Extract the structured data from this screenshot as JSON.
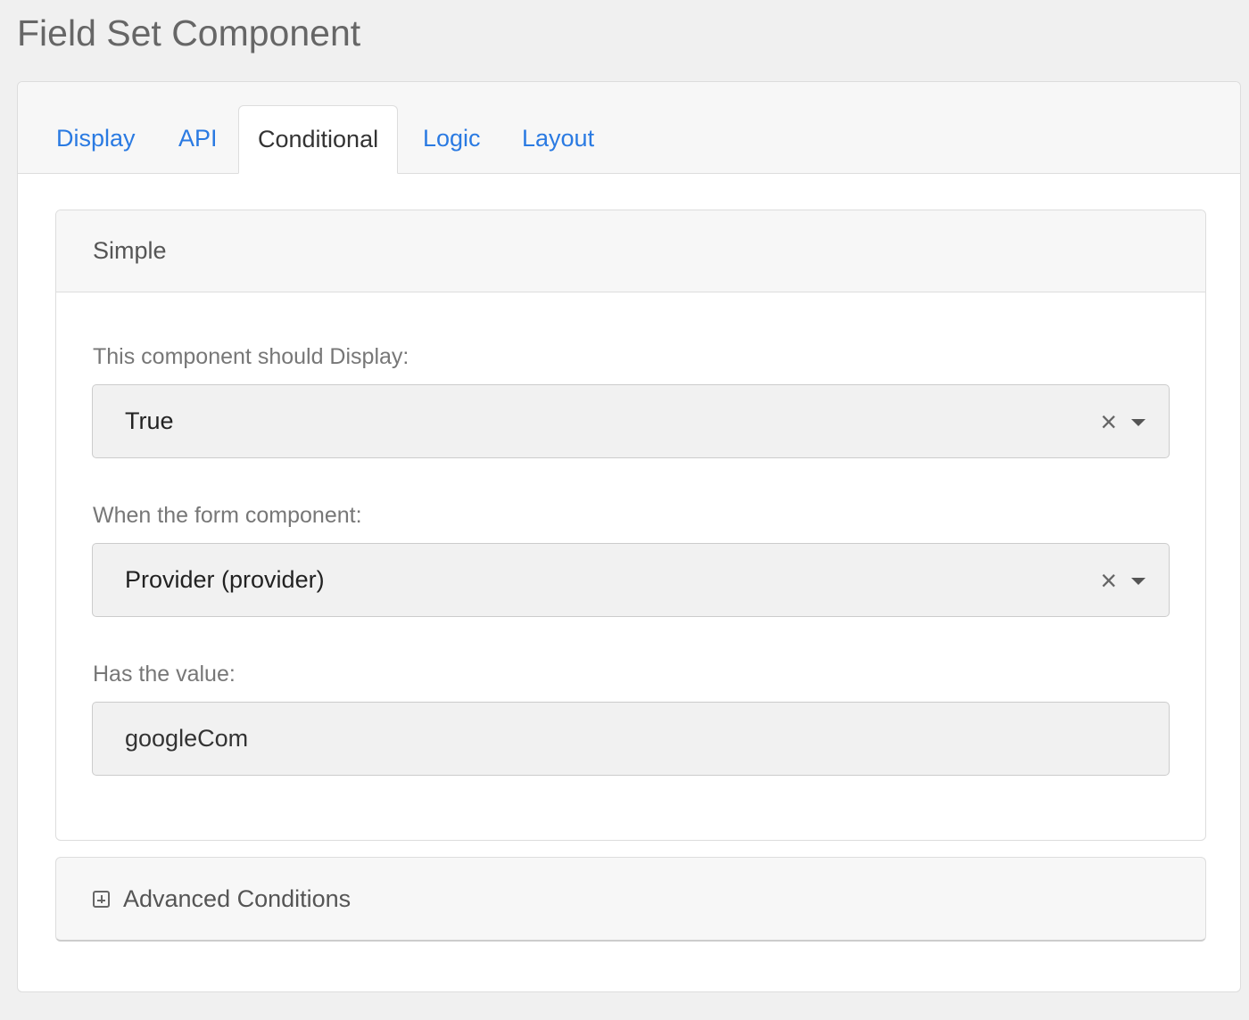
{
  "page": {
    "title": "Field Set Component"
  },
  "tabs": [
    {
      "label": "Display",
      "active": false
    },
    {
      "label": "API",
      "active": false
    },
    {
      "label": "Conditional",
      "active": true
    },
    {
      "label": "Logic",
      "active": false
    },
    {
      "label": "Layout",
      "active": false
    }
  ],
  "simple": {
    "heading": "Simple",
    "display_label": "This component should Display:",
    "display_value": "True",
    "when_label": "When the form component:",
    "when_value": "Provider (provider)",
    "value_label": "Has the value:",
    "value_input": "googleCom"
  },
  "advanced": {
    "heading": "Advanced Conditions"
  },
  "icons": {
    "clear": "close-icon",
    "caret": "chevron-down-icon",
    "expand": "plus-box-icon"
  },
  "colors": {
    "link": "#2a7ae2",
    "background": "#f0f0f0",
    "panel_heading": "#f7f7f7",
    "input_background": "#f1f1f1"
  }
}
